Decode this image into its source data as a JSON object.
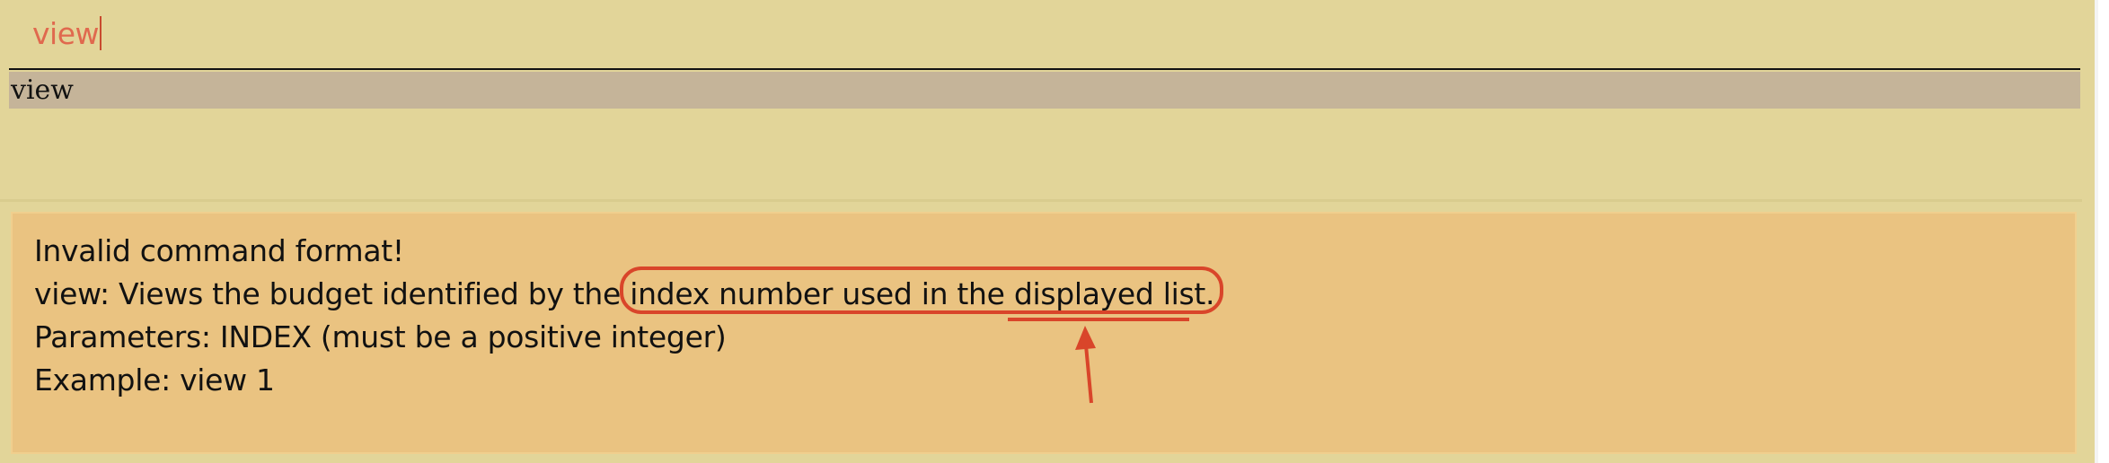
{
  "command_box": {
    "value": "view"
  },
  "suggestions": [
    {
      "label": "view"
    }
  ],
  "result": {
    "lines": [
      "Invalid command format!",
      "view: Views the budget identified by the index number used in the displayed list.",
      "Parameters: INDEX (must be a positive integer)",
      "Example: view 1"
    ]
  },
  "annotation": {
    "color": "#d9452a",
    "shapes": [
      "rounded-rectangle-highlight",
      "underline",
      "arrow-up"
    ]
  },
  "colors": {
    "background": "#e2d599",
    "input_text": "#e0694e",
    "suggestion_highlight": "#c5b499",
    "result_panel": "#eac381"
  }
}
